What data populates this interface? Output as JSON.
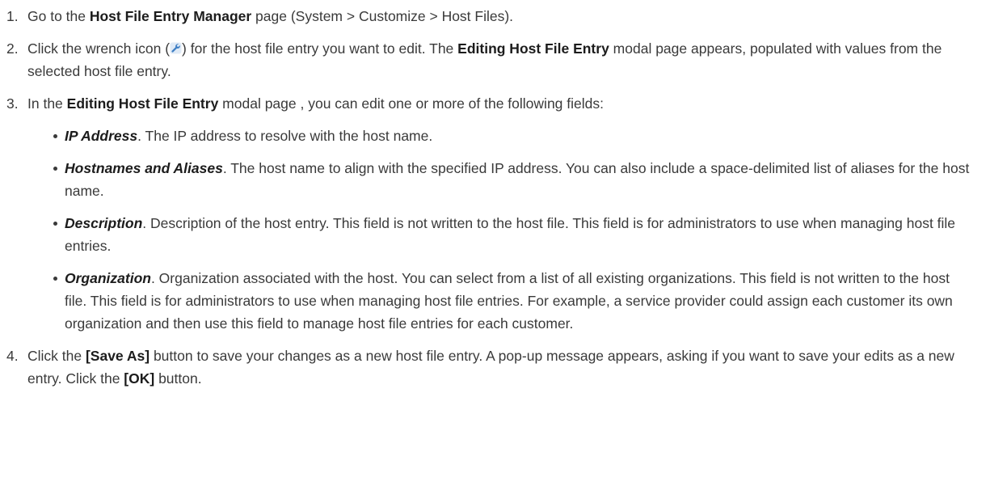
{
  "steps": [
    {
      "number": "1.",
      "pre": "Go to the ",
      "bold1": "Host File Entry Manager",
      "post": " page (System > Customize > Host Files)."
    },
    {
      "number": "2.",
      "pre": "Click the wrench icon (",
      "icon": "wrench-icon",
      "mid": ") for the host file entry you want to edit. The ",
      "bold1": "Editing Host File Entry",
      "post": " modal page appears, populated with values from the selected host file entry."
    },
    {
      "number": "3.",
      "pre": "In the ",
      "bold1": "Editing Host File Entry",
      "post": " modal page , you can edit one or more of the following fields:",
      "fields": [
        {
          "name": "IP Address",
          "text": ". The IP address to resolve with the host name."
        },
        {
          "name": "Hostnames and Aliases",
          "text": ". The host name to align with the specified IP address. You can also include a space-delimited list of aliases for the host name."
        },
        {
          "name": "Description",
          "text": ". Description of the host entry. This field is not written to the host file. This field is for administrators to use when managing host file entries."
        },
        {
          "name": "Organization",
          "text": ". Organization associated with the host. You can select from a list of all existing organizations. This field is not written to the host file. This field is for administrators to use when managing host file entries. For example, a service provider could assign each customer its own organization and then use this field to manage host file entries for each customer."
        }
      ]
    },
    {
      "number": "4.",
      "pre": "Click the ",
      "bold1": "[Save As]",
      "mid": " button to save your changes as a new host file entry. A pop-up message appears, asking if you want to save your edits as a new entry. Click the ",
      "bold2": "[OK]",
      "post": " button."
    }
  ],
  "colors": {
    "text": "#3a3a3a",
    "icon_blue": "#3f7fc4",
    "icon_bg": "#dfeaf6"
  }
}
